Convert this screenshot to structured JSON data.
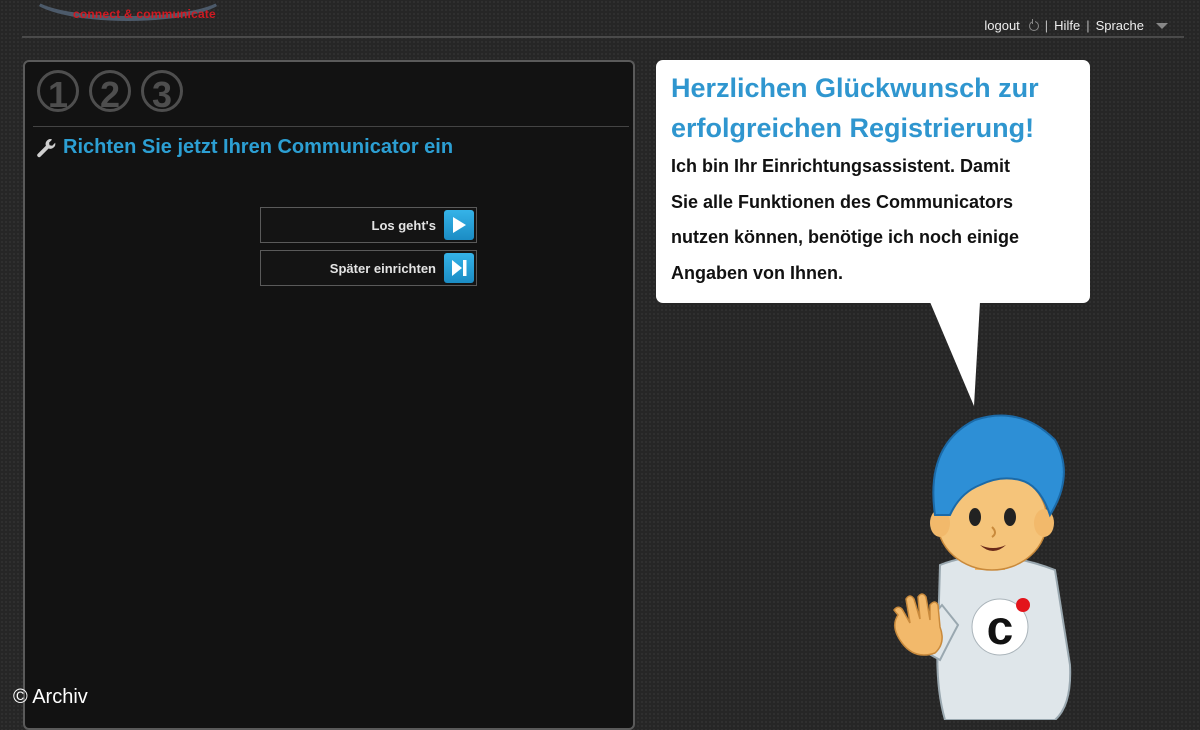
{
  "header": {
    "logo_tagline": "connect & communicate",
    "nav": {
      "logout": "logout",
      "help": "Hilfe",
      "language": "Sprache",
      "separator": "|"
    }
  },
  "wizard": {
    "steps": [
      "1",
      "2",
      "3"
    ],
    "title": "Richten Sie jetzt Ihren Communicator ein",
    "buttons": {
      "start": "Los geht's",
      "later": "Später einrichten"
    }
  },
  "bubble": {
    "title": "Herzlichen Glückwunsch zur erfolgreichen Registrierung!",
    "lines": [
      "Ich bin Ihr Einrichtungsassistent. Damit",
      "Sie alle Funktionen des Communicators",
      "nutzen können, benötige ich noch einige",
      "Angaben von Ihnen."
    ]
  },
  "mascot": {
    "shirt_logo": "c"
  },
  "copyright": "© Archiv",
  "colors": {
    "accent_blue": "#2c9fd3",
    "brand_red": "#d01a22",
    "background": "#262626",
    "panel": "#121212"
  },
  "icons": [
    "power-icon",
    "caret-down-icon",
    "wrench-icon",
    "play-icon",
    "skip-forward-icon"
  ]
}
